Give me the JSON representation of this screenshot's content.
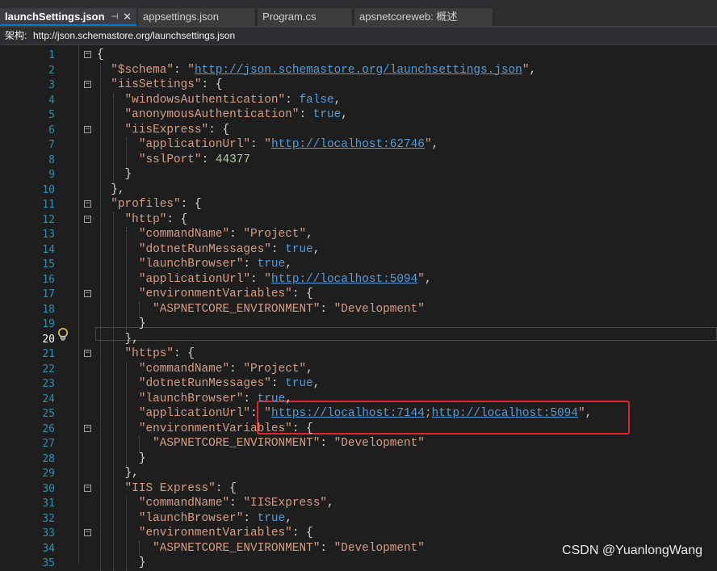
{
  "tabs": [
    {
      "label": "launchSettings.json",
      "active": true
    },
    {
      "label": "appsettings.json",
      "active": false
    },
    {
      "label": "Program.cs",
      "active": false
    },
    {
      "label": "apsnetcoreweb: 概述",
      "active": false
    }
  ],
  "tab_pin_icon": "pin-icon",
  "tab_close_icon": "close-icon",
  "schema_bar": {
    "label": "架构:",
    "value": "http://json.schemastore.org/launchsettings.json"
  },
  "current_line": 20,
  "lines": [
    "{",
    "  \"$schema\": \"http://json.schemastore.org/launchsettings.json\",",
    "  \"iisSettings\": {",
    "    \"windowsAuthentication\": false,",
    "    \"anonymousAuthentication\": true,",
    "    \"iisExpress\": {",
    "      \"applicationUrl\": \"http://localhost:62746\",",
    "      \"sslPort\": 44377",
    "    }",
    "  },",
    "  \"profiles\": {",
    "    \"http\": {",
    "      \"commandName\": \"Project\",",
    "      \"dotnetRunMessages\": true,",
    "      \"launchBrowser\": true,",
    "      \"applicationUrl\": \"http://localhost:5094\",",
    "      \"environmentVariables\": {",
    "        \"ASPNETCORE_ENVIRONMENT\": \"Development\"",
    "      }",
    "    },",
    "    \"https\": {",
    "      \"commandName\": \"Project\",",
    "      \"dotnetRunMessages\": true,",
    "      \"launchBrowser\": true,",
    "      \"applicationUrl\": \"https://localhost:7144;http://localhost:5094\",",
    "      \"environmentVariables\": {",
    "        \"ASPNETCORE_ENVIRONMENT\": \"Development\"",
    "      }",
    "    },",
    "    \"IIS Express\": {",
    "      \"commandName\": \"IISExpress\",",
    "      \"launchBrowser\": true,",
    "      \"environmentVariables\": {",
    "        \"ASPNETCORE_ENVIRONMENT\": \"Development\"",
    "      }"
  ],
  "fold_lines": [
    1,
    3,
    6,
    11,
    12,
    17,
    21,
    26,
    30,
    33
  ],
  "lightbulb_icon": "lightbulb-icon",
  "highlighted_line": 25,
  "watermark": "CSDN @YuanlongWang",
  "colors": {
    "background": "#1e1e1e",
    "line_number": "#2b91af",
    "json_key": "#d69d85",
    "json_string": "#d69d85",
    "url": "#569cd6",
    "keyword": "#569cd6",
    "number": "#b5cea8",
    "highlight_box": "#e0262a",
    "active_tab_accent": "#007acc"
  }
}
